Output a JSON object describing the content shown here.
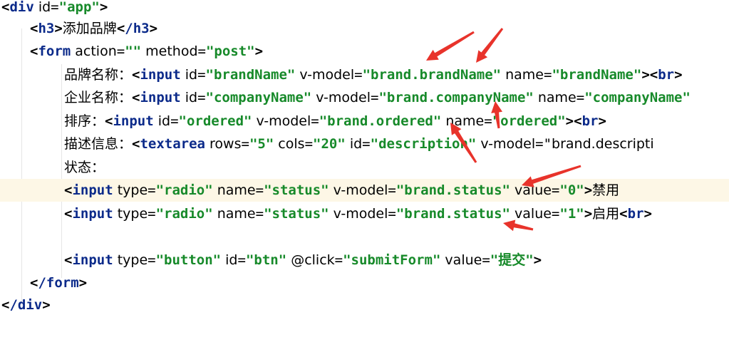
{
  "code_lines": [
    {
      "text": "<div id=\"app\">"
    },
    {
      "text": "<h3>添加品牌</h3>"
    },
    {
      "text": "<form action=\"\" method=\"post\">"
    },
    {
      "text": "品牌名称：<input id=\"brandName\" v-model=\"brand.brandName\" name=\"brandName\"><br>"
    },
    {
      "text": "企业名称：<input id=\"companyName\" v-model=\"brand.companyName\" name=\"companyName\""
    },
    {
      "text": "排序：<input id=\"ordered\" v-model=\"brand.ordered\" name=\"ordered\"><br>"
    },
    {
      "text": "描述信息：<textarea rows=\"5\" cols=\"20\" id=\"description\" v-model=\"brand.descripti"
    },
    {
      "text": "状态："
    },
    {
      "text": "<input type=\"radio\" name=\"status\" v-model=\"brand.status\" value=\"0\">禁用"
    },
    {
      "text": "<input type=\"radio\" name=\"status\" v-model=\"brand.status\" value=\"1\">启用<br>"
    },
    {
      "text": ""
    },
    {
      "text": "<input type=\"button\" id=\"btn\" @click=\"submitForm\" value=\"提交\">"
    },
    {
      "text": "</form>"
    },
    {
      "text": "</div>"
    }
  ],
  "annotation_color": "#e8332b"
}
